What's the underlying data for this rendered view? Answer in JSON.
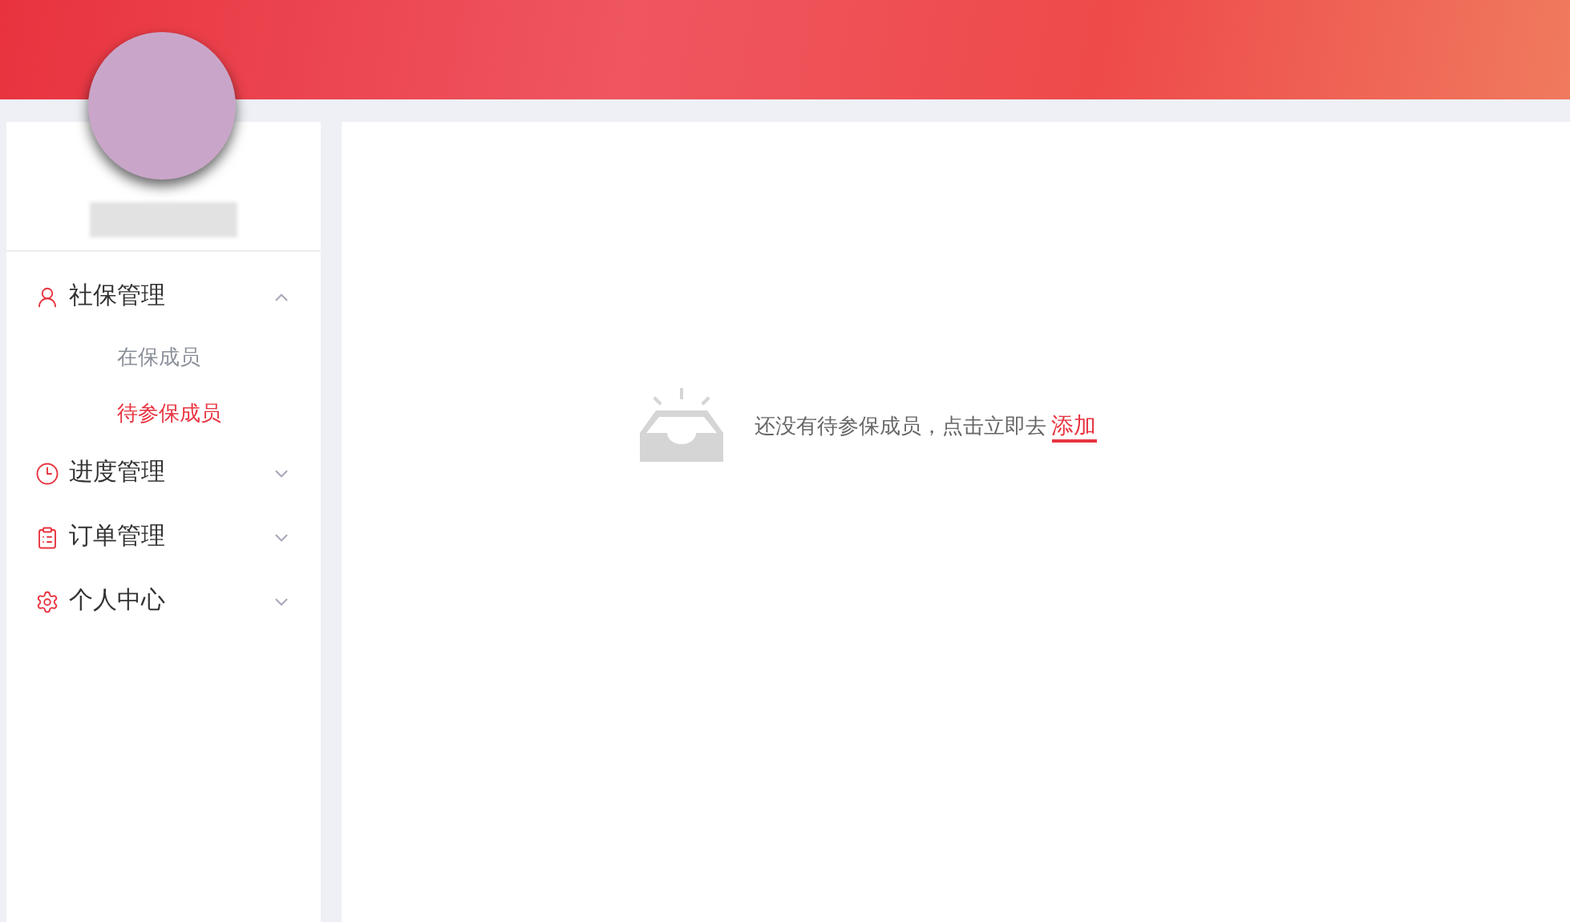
{
  "sidebar": {
    "menu": [
      {
        "label": "社保管理",
        "expanded": true,
        "children": [
          {
            "label": "在保成员",
            "selected": false
          },
          {
            "label": "待参保成员",
            "selected": true
          }
        ]
      },
      {
        "label": "进度管理",
        "expanded": false
      },
      {
        "label": "订单管理",
        "expanded": false
      },
      {
        "label": "个人中心",
        "expanded": false
      }
    ]
  },
  "empty_state": {
    "message": "还没有待参保成员，点击立即去",
    "link": "添加"
  }
}
